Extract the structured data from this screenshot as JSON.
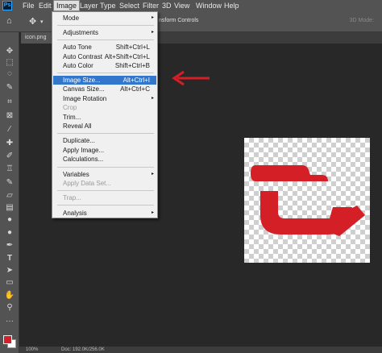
{
  "menubar": {
    "logo": "Ps",
    "items": [
      "File",
      "Edit",
      "Image",
      "Layer",
      "Type",
      "Select",
      "Filter",
      "3D",
      "View",
      "Window",
      "Help"
    ]
  },
  "options_bar": {
    "transform_text": "nsform Controls",
    "mode_3d": "3D Mode:"
  },
  "document_tab": {
    "label": "icon.png @"
  },
  "status_bar": {
    "zoom": "100%",
    "doc_info": "Doc: 192.0K/256.0K"
  },
  "image_menu": {
    "items": [
      {
        "label": "Mode",
        "shortcut": "",
        "submenu": true,
        "disabled": false
      },
      {
        "label": "Adjustments",
        "shortcut": "",
        "submenu": true,
        "disabled": false
      },
      {
        "label": "Auto Tone",
        "shortcut": "Shift+Ctrl+L",
        "submenu": false,
        "disabled": false
      },
      {
        "label": "Auto Contrast",
        "shortcut": "Alt+Shift+Ctrl+L",
        "submenu": false,
        "disabled": false
      },
      {
        "label": "Auto Color",
        "shortcut": "Shift+Ctrl+B",
        "submenu": false,
        "disabled": false
      },
      {
        "label": "Image Size...",
        "shortcut": "Alt+Ctrl+I",
        "submenu": false,
        "disabled": false
      },
      {
        "label": "Canvas Size...",
        "shortcut": "Alt+Ctrl+C",
        "submenu": false,
        "disabled": false
      },
      {
        "label": "Image Rotation",
        "shortcut": "",
        "submenu": true,
        "disabled": false
      },
      {
        "label": "Crop",
        "shortcut": "",
        "submenu": false,
        "disabled": true
      },
      {
        "label": "Trim...",
        "shortcut": "",
        "submenu": false,
        "disabled": false
      },
      {
        "label": "Reveal All",
        "shortcut": "",
        "submenu": false,
        "disabled": false
      },
      {
        "label": "Duplicate...",
        "shortcut": "",
        "submenu": false,
        "disabled": false
      },
      {
        "label": "Apply Image...",
        "shortcut": "",
        "submenu": false,
        "disabled": false
      },
      {
        "label": "Calculations...",
        "shortcut": "",
        "submenu": false,
        "disabled": false
      },
      {
        "label": "Variables",
        "shortcut": "",
        "submenu": true,
        "disabled": false
      },
      {
        "label": "Apply Data Set...",
        "shortcut": "",
        "submenu": false,
        "disabled": true
      },
      {
        "label": "Trap...",
        "shortcut": "",
        "submenu": false,
        "disabled": true
      },
      {
        "label": "Analysis",
        "shortcut": "",
        "submenu": true,
        "disabled": false
      }
    ]
  },
  "colors": {
    "accent_red": "#d41f27",
    "highlight": "#3377cc",
    "foreground_swatch": "#d41f27",
    "background_swatch": "#ffffff"
  },
  "icons": {
    "submenu_arrow": "▸",
    "move_tool": "move-icon",
    "home": "home-icon"
  }
}
